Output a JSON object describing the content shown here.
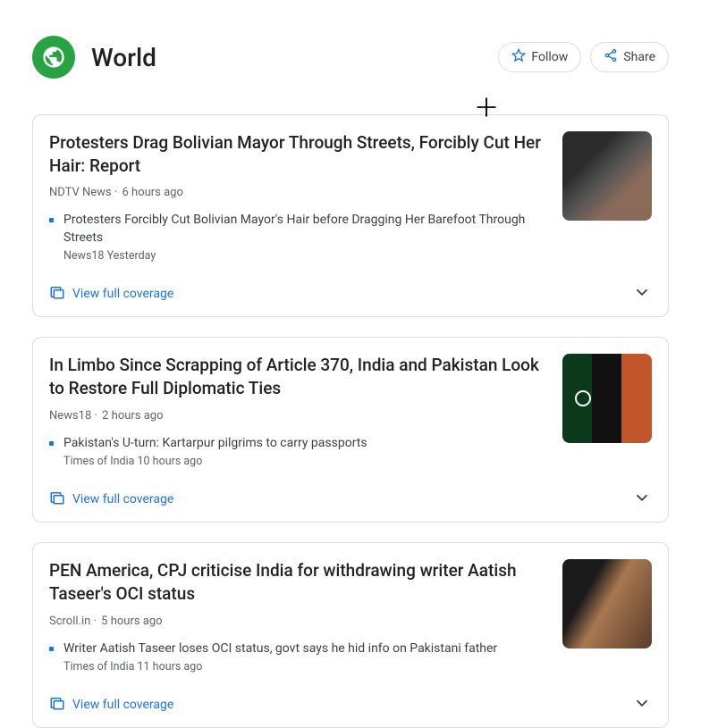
{
  "header": {
    "title": "World",
    "follow_label": "Follow",
    "share_label": "Share"
  },
  "coverage_label": "View full coverage",
  "cards": [
    {
      "headline": "Protesters Drag Bolivian Mayor Through Streets, Forcibly Cut Her Hair: Report",
      "source": "NDTV News",
      "time": "6 hours ago",
      "sub_title": "Protesters Forcibly Cut Bolivian Mayor's Hair before Dragging Her Barefoot Through Streets",
      "sub_source": "News18",
      "sub_time": "Yesterday"
    },
    {
      "headline": "In Limbo Since Scrapping of Article 370, India and Pakistan Look to Restore Full Diplomatic Ties",
      "source": "News18",
      "time": "2 hours ago",
      "sub_title": "Pakistan's U-turn: Kartarpur pilgrims to carry passports",
      "sub_source": "Times of India",
      "sub_time": "10 hours ago"
    },
    {
      "headline": "PEN America, CPJ criticise India for withdrawing writer Aatish Taseer's OCI status",
      "source": "Scroll.in",
      "time": "5 hours ago",
      "sub_title": "Writer Aatish Taseer loses OCI status, govt says he hid info on Pakistani father",
      "sub_source": "Times of India",
      "sub_time": "11 hours ago"
    }
  ]
}
